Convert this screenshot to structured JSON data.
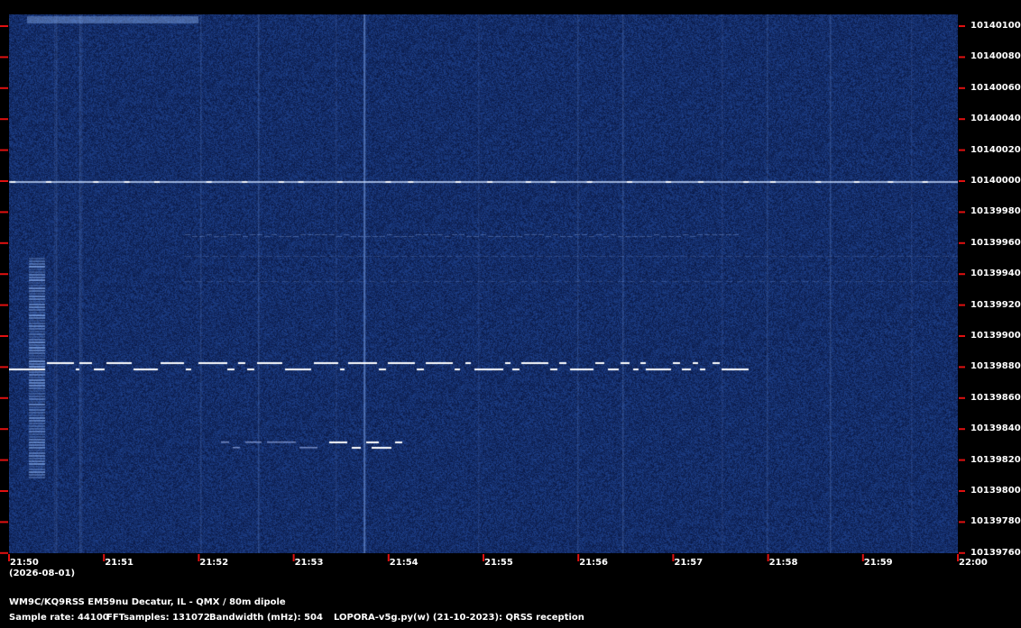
{
  "spectrogram": {
    "carrier_freq": "10140000",
    "signals": {
      "main_trace_freq": "10139876",
      "secondary_trace_freq": "10139830",
      "faint_trace_freq": "10139962"
    }
  },
  "y_axis": {
    "labels": [
      "10140100",
      "10140080",
      "10140060",
      "10140040",
      "10140020",
      "10140000",
      "10139980",
      "10139960",
      "10139940",
      "10139920",
      "10139900",
      "10139880",
      "10139860",
      "10139840",
      "10139820",
      "10139800",
      "10139780",
      "10139760"
    ]
  },
  "x_axis": {
    "labels": [
      "21:50",
      "21:51",
      "21:52",
      "21:53",
      "21:54",
      "21:55",
      "21:56",
      "21:57",
      "21:58",
      "21:59",
      "22:00"
    ],
    "date": "(2026-08-01)"
  },
  "footer": {
    "station": "WM9C/KQ9RSS EM59nu Decatur, IL - QMX / 80m dipole",
    "sample_rate": "Sample rate: 44100",
    "fft_samples": "FFTsamples: 131072",
    "bandwidth": "Bandwidth (mHz): 504",
    "software": "LOPORA-v5g.py(w) (21-10-2023): QRSS reception"
  },
  "colors": {
    "background": "#0b1a4a",
    "tick": "#e01010",
    "signal": "#ffffff"
  }
}
